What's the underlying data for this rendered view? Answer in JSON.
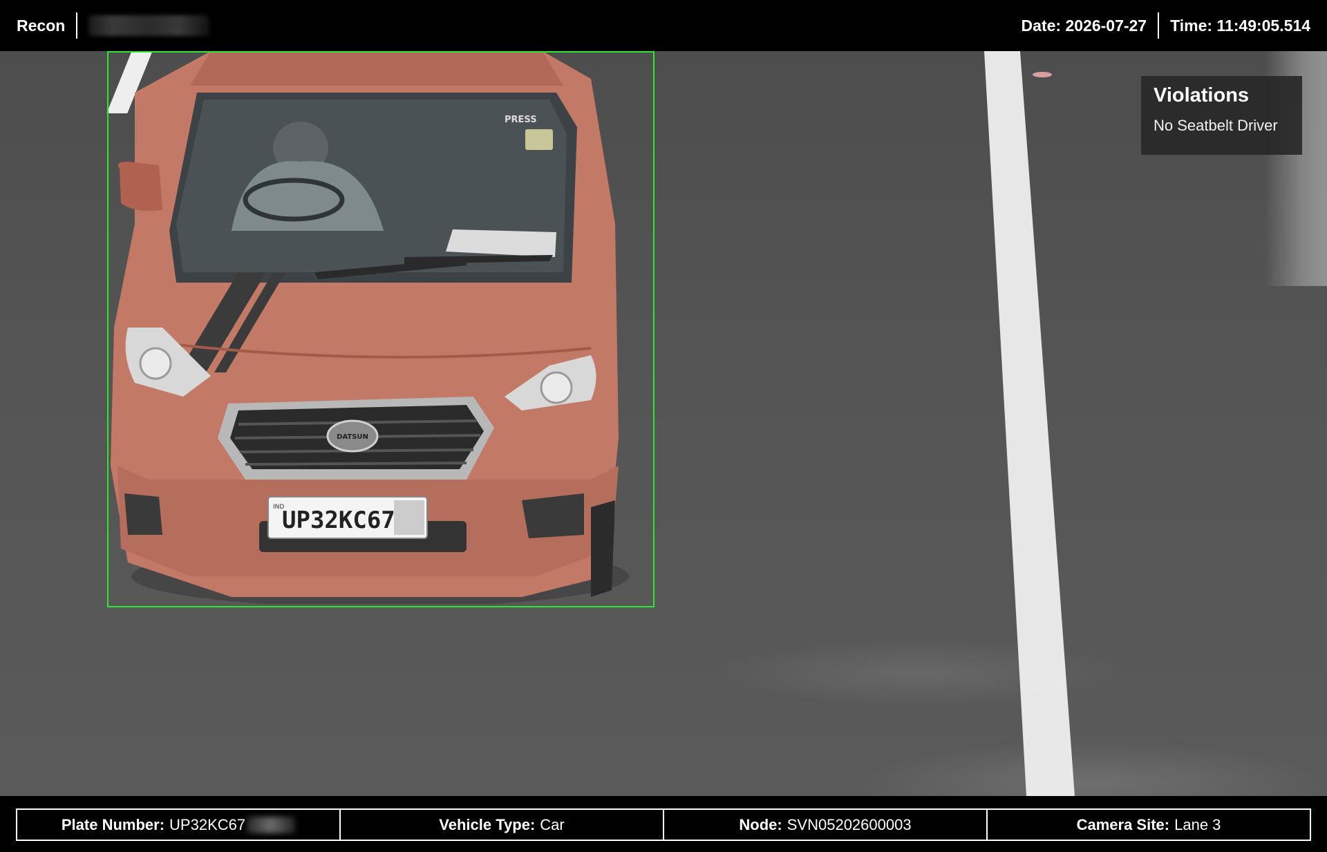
{
  "topbar": {
    "app_name": "Recon",
    "date_text": "Date: 2026-07-27",
    "time_text": "Time: 11:49:05.514"
  },
  "scene": {
    "plate_on_car": "UP32KC67",
    "car_brand_badge": "DATSUN",
    "windshield_sticker": "PRESS",
    "plate_country": "IND"
  },
  "violations": {
    "title": "Violations",
    "items": [
      "No Seatbelt Driver"
    ]
  },
  "info": {
    "plate_label": "Plate Number:",
    "plate_value": "UP32KC67",
    "vehicle_label": "Vehicle Type:",
    "vehicle_value": "Car",
    "node_label": "Node:",
    "node_value": "SVN05202600003",
    "site_label": "Camera Site:",
    "site_value": "Lane 3"
  },
  "colors": {
    "detection_box": "#2ee82e",
    "car_body": "#c27a66"
  },
  "icons": []
}
